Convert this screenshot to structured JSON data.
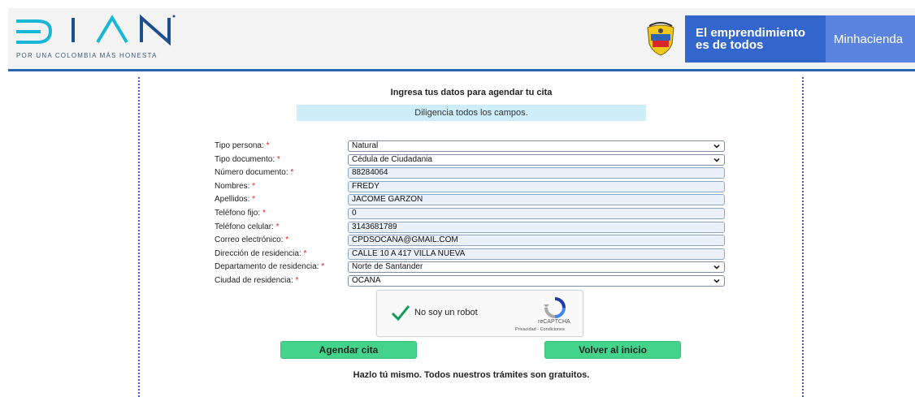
{
  "header": {
    "brand": "DIAN",
    "tagline": "POR UNA COLOMBIA MÁS HONESTA",
    "gov_line1": "El emprendimiento",
    "gov_line2": "es de todos",
    "ministry": "Minhacienda",
    "accent_color": "#2a67b1"
  },
  "form": {
    "title": "Ingresa tus datos para agendar tu cita",
    "notice": "Diligencia todos los campos.",
    "required_mark": "*",
    "fields": [
      {
        "label": "Tipo persona:",
        "value": "Natural",
        "kind": "select"
      },
      {
        "label": "Tipo documento:",
        "value": "Cédula de Ciudadania",
        "kind": "select"
      },
      {
        "label": "Número documento:",
        "value": "88284064",
        "kind": "text"
      },
      {
        "label": "Nombres:",
        "value": "FREDY",
        "kind": "text"
      },
      {
        "label": "Apellidos:",
        "value": "JACOME GARZON",
        "kind": "text"
      },
      {
        "label": "Teléfono fijo:",
        "value": "0",
        "kind": "text"
      },
      {
        "label": "Teléfono celular:",
        "value": "3143681789",
        "kind": "text"
      },
      {
        "label": "Correo electrónico:",
        "value": "CPDSOCANA@GMAIL.COM",
        "kind": "text"
      },
      {
        "label": "Dirección de residencia:",
        "value": "CALLE 10 A 417 VILLA NUEVA",
        "kind": "text"
      },
      {
        "label": "Departamento de residencia:",
        "value": "Norte de Santander",
        "kind": "select"
      },
      {
        "label": "Ciudad de residencia:",
        "value": "OCAÑA",
        "kind": "select"
      }
    ]
  },
  "captcha": {
    "label": "No soy un robot",
    "brand": "reCAPTCHA",
    "links": "Privacidad - Condiciones",
    "icon": "check-icon"
  },
  "buttons": {
    "schedule": "Agendar cita",
    "back": "Volver al inicio",
    "color": "#44d38a"
  },
  "footer": {
    "note": "Hazlo tú mismo. Todos nuestros trámites son gratuitos."
  }
}
